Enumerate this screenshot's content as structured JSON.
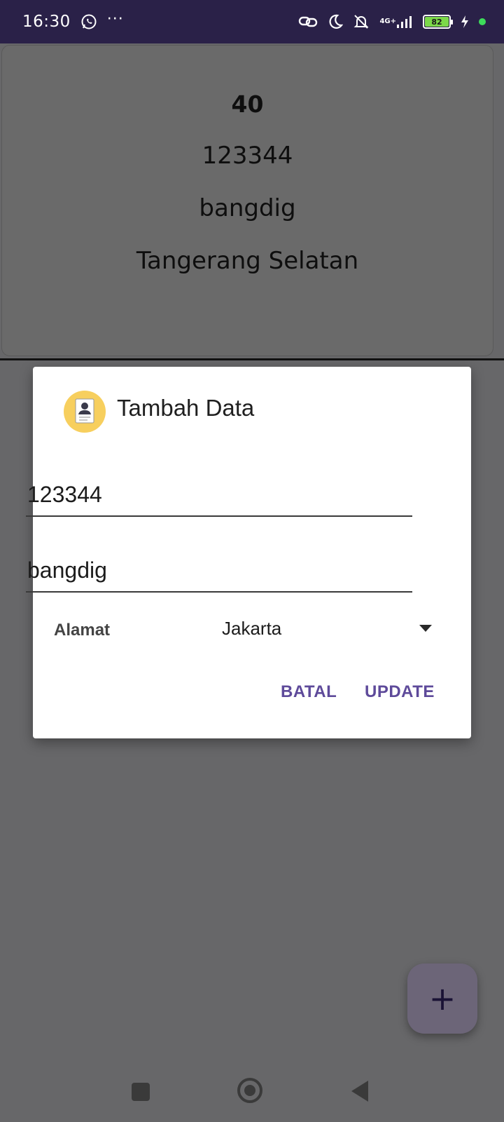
{
  "status_bar": {
    "time": "16:30",
    "more": "···",
    "network": "4G+",
    "battery": "82",
    "colors": {
      "background": "#2a2148",
      "battery_fill": "#7cd94a",
      "active_dot": "#3ddc5a"
    },
    "icons": [
      "whatsapp-icon",
      "link-icon",
      "do-not-disturb-moon-icon",
      "bell-off-icon",
      "signal-icon",
      "battery-icon",
      "charging-icon"
    ]
  },
  "card": {
    "id": "40",
    "nim": "123344",
    "name": "bangdig",
    "address": "Tangerang Selatan"
  },
  "dialog": {
    "title": "Tambah Data",
    "icon": "resume-document-icon",
    "nim_value": "123344",
    "name_value": "bangdig",
    "address_label": "Alamat",
    "address_selected": "Jakarta",
    "cancel_label": "BATAL",
    "update_label": "UPDATE",
    "colors": {
      "button_text": "#5e4a9a",
      "icon_bg": "#f7cf5e"
    }
  },
  "fab": {
    "label": "+",
    "icon": "plus-icon"
  },
  "nav": {
    "icons": [
      "recents-square-icon",
      "home-circle-icon",
      "back-triangle-icon"
    ]
  }
}
